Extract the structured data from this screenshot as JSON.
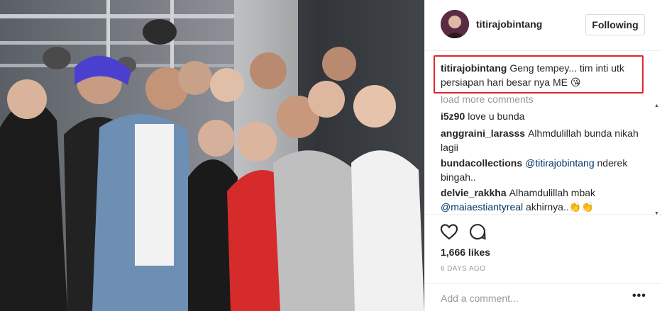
{
  "post": {
    "username": "titirajobintang",
    "follow_label": "Following",
    "caption": {
      "username": "titirajobintang",
      "text": "Geng tempey... tim inti utk persiapan hari besar nya ME 😘"
    },
    "load_more": "load more comments",
    "comments": [
      {
        "username": "i5z90",
        "text": "love u bunda",
        "mention": "",
        "after": ""
      },
      {
        "username": "anggraini_larasss",
        "text": "Alhmdulillah bunda nikah lagii",
        "mention": "",
        "after": ""
      },
      {
        "username": "bundacollections",
        "text": "",
        "mention": "@titirajobintang",
        "after": "nderek bingah.."
      },
      {
        "username": "delvie_rakkha",
        "text": "Alhamdulillah mbak",
        "mention": "@maiaestiantyreal",
        "after": "akhirnya..👏👏"
      }
    ],
    "likes": "1,666 likes",
    "date": "6 DAYS AGO",
    "comment_placeholder": "Add a comment...",
    "more_label": "•••"
  },
  "icons": {
    "like": "heart-icon",
    "comment": "comment-icon",
    "more": "more-options-icon"
  },
  "colors": {
    "highlight_border": "#e0262d",
    "mention": "#003569",
    "muted": "#999999",
    "text": "#262626"
  }
}
